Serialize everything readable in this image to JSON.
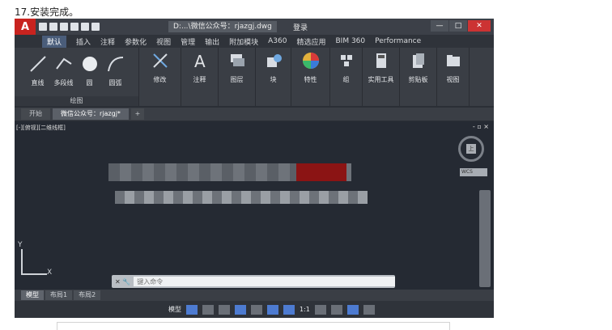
{
  "caption": "17.安装完成。",
  "app": {
    "logo": "A",
    "title": "D:...\\微信公众号：rjazgj.dwg",
    "signin": "登录",
    "window_controls": [
      "—",
      "□",
      "✕"
    ]
  },
  "ribbon_tabs": [
    "默认",
    "插入",
    "注释",
    "参数化",
    "视图",
    "管理",
    "输出",
    "附加模块",
    "A360",
    "精选应用",
    "BIM 360",
    "Performance"
  ],
  "ribbon": {
    "draw_tools": [
      "直线",
      "多段线",
      "圆",
      "圆弧"
    ],
    "draw_panel_label": "绘图",
    "panels": [
      "修改",
      "注释",
      "图层",
      "块",
      "特性",
      "组",
      "实用工具",
      "剪贴板",
      "视图"
    ]
  },
  "doc_tabs": {
    "start": "开始",
    "active": "微信公众号：rjazgj*",
    "plus": "+"
  },
  "viewport": {
    "label": "[-][俯视][二维线框]",
    "controls": "- ▫ ×",
    "compass_top": "上",
    "wcs": "WCS",
    "ucs_y": "Y",
    "ucs_x": "X"
  },
  "command": {
    "placeholder": "键入命令",
    "prefix": "✕ 🔧"
  },
  "layout_tabs": [
    "模型",
    "布局1",
    "布局2"
  ],
  "statusbar": {
    "model": "模型",
    "scale": "1:1"
  },
  "colors": {
    "accent_red": "#c8231f",
    "canvas": "#252a33",
    "active_tab": "#4a5d7a"
  }
}
